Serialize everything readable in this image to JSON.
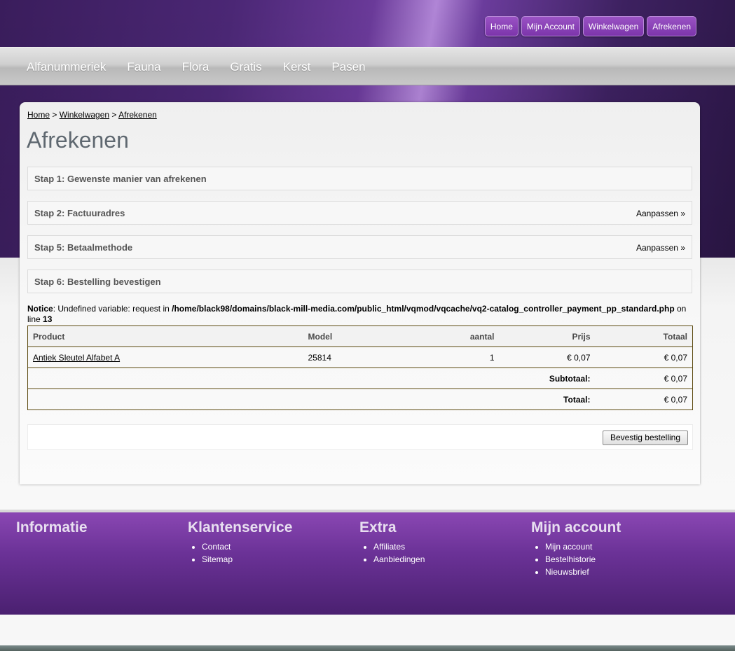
{
  "top_nav": {
    "home": "Home",
    "account": "Mijn Account",
    "cart": "Winkelwagen",
    "checkout": "Afrekenen"
  },
  "categories": [
    "Alfanummeriek",
    "Fauna",
    "Flora",
    "Gratis",
    "Kerst",
    "Pasen"
  ],
  "breadcrumb": {
    "home": "Home",
    "cart": "Winkelwagen",
    "checkout": "Afrekenen",
    "separator": " > "
  },
  "page_title": "Afrekenen",
  "steps": [
    {
      "title": "Stap 1: Gewenste manier van afrekenen",
      "edit": ""
    },
    {
      "title": "Stap 2: Factuuradres",
      "edit": "Aanpassen »"
    },
    {
      "title": "Stap 5: Betaalmethode",
      "edit": "Aanpassen »"
    },
    {
      "title": "Stap 6: Bestelling bevestigen",
      "edit": ""
    }
  ],
  "notice": {
    "label": "Notice",
    "message": ": Undefined variable: request in ",
    "path": "/home/black98/domains/black-mill-media.com/public_html/vqmod/vqcache/vq2-catalog_controller_payment_pp_standard.php",
    "on_line": " on line ",
    "line": "13"
  },
  "cart_table": {
    "headers": {
      "product": "Product",
      "model": "Model",
      "qty": "aantal",
      "price": "Prijs",
      "total": "Totaal"
    },
    "rows": [
      {
        "product": "Antiek Sleutel Alfabet A",
        "model": "25814",
        "qty": "1",
        "price": "€ 0,07",
        "total": "€ 0,07"
      }
    ],
    "subtotal_label": "Subtotaal:",
    "subtotal_value": "€ 0,07",
    "total_label": "Totaal:",
    "total_value": "€ 0,07"
  },
  "confirm_button": "Bevestig bestelling",
  "footer": {
    "info": {
      "title": "Informatie"
    },
    "service": {
      "title": "Klantenservice",
      "items": [
        "Contact",
        "Sitemap"
      ]
    },
    "extra": {
      "title": "Extra",
      "items": [
        "Affiliates",
        "Aanbiedingen"
      ]
    },
    "account": {
      "title": "Mijn account",
      "items": [
        "Mijn account",
        "Bestelhistorie",
        "Nieuwsbrief"
      ]
    }
  }
}
